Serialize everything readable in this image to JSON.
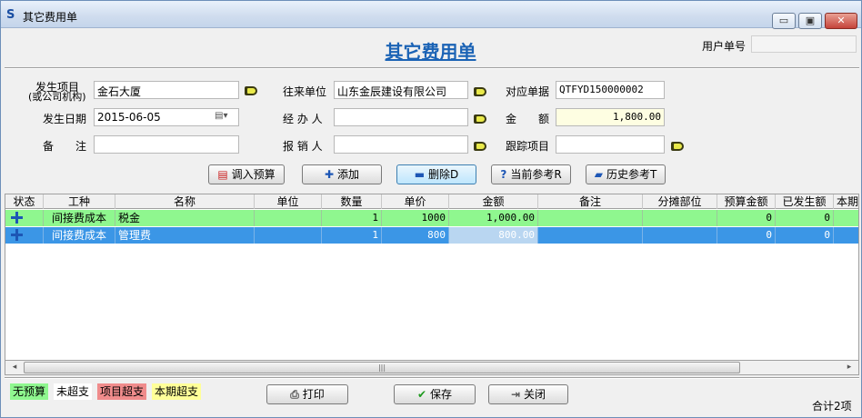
{
  "window": {
    "app_icon": "S",
    "title": "其它费用单",
    "minimize": "▭",
    "maximize": "▣",
    "close": "✕"
  },
  "header": {
    "form_title": "其它费用单",
    "user_no_label": "用户单号",
    "user_no_value": ""
  },
  "form": {
    "occur_item_label_1": "发生项目",
    "occur_item_label_2": "(或公司机构)",
    "occur_item_value": "金石大厦",
    "partner_label": "往来单位",
    "partner_value": "山东金辰建设有限公司",
    "ref_doc_label": "对应单据",
    "ref_doc_value": "QTFYD150000002",
    "date_label": "发生日期",
    "date_value": "2015-06-05",
    "handler_label": "经 办 人",
    "handler_value": "",
    "amount_label": "金　　额",
    "amount_value": "1,800.00",
    "remark_label": "备　　注",
    "remark_value": "",
    "reimburser_label": "报 销 人",
    "reimburser_value": "",
    "track_item_label": "跟踪项目",
    "track_item_value": "",
    "calendar_icon": "calendar-icon"
  },
  "toolbar": {
    "import_budget": "调入预算",
    "add": "添加",
    "delete": "删除D",
    "current_ref": "当前参考R",
    "history_ref": "历史参考T"
  },
  "table": {
    "columns": [
      "状态",
      "工种",
      "名称",
      "单位",
      "数量",
      "单价",
      "金额",
      "备注",
      "分摊部位",
      "预算金额",
      "已发生额",
      "本期"
    ],
    "rows": [
      {
        "type": "间接费成本",
        "name": "税金",
        "unit": "",
        "qty": "1",
        "price": "1000",
        "amount": "1,000.00",
        "remark": "",
        "part": "",
        "budget": "0",
        "occurred": "0"
      },
      {
        "type": "间接费成本",
        "name": "管理费",
        "unit": "",
        "qty": "1",
        "price": "800",
        "amount": "800.00",
        "remark": "",
        "part": "",
        "budget": "0",
        "occurred": "0"
      }
    ]
  },
  "legend": {
    "no_budget": "无预算",
    "not_over": "未超支",
    "item_over": "项目超支",
    "period_over": "本期超支",
    "colors": {
      "no_budget": "#8ff78f",
      "not_over": "#ffffff",
      "item_over": "#f08c8c",
      "period_over": "#ffff99"
    }
  },
  "footer": {
    "print": "打印",
    "save": "保存",
    "close": "关闭",
    "total": "合计2项"
  },
  "scroll": {
    "left": "◂",
    "right": "▸",
    "grip": "|||"
  }
}
